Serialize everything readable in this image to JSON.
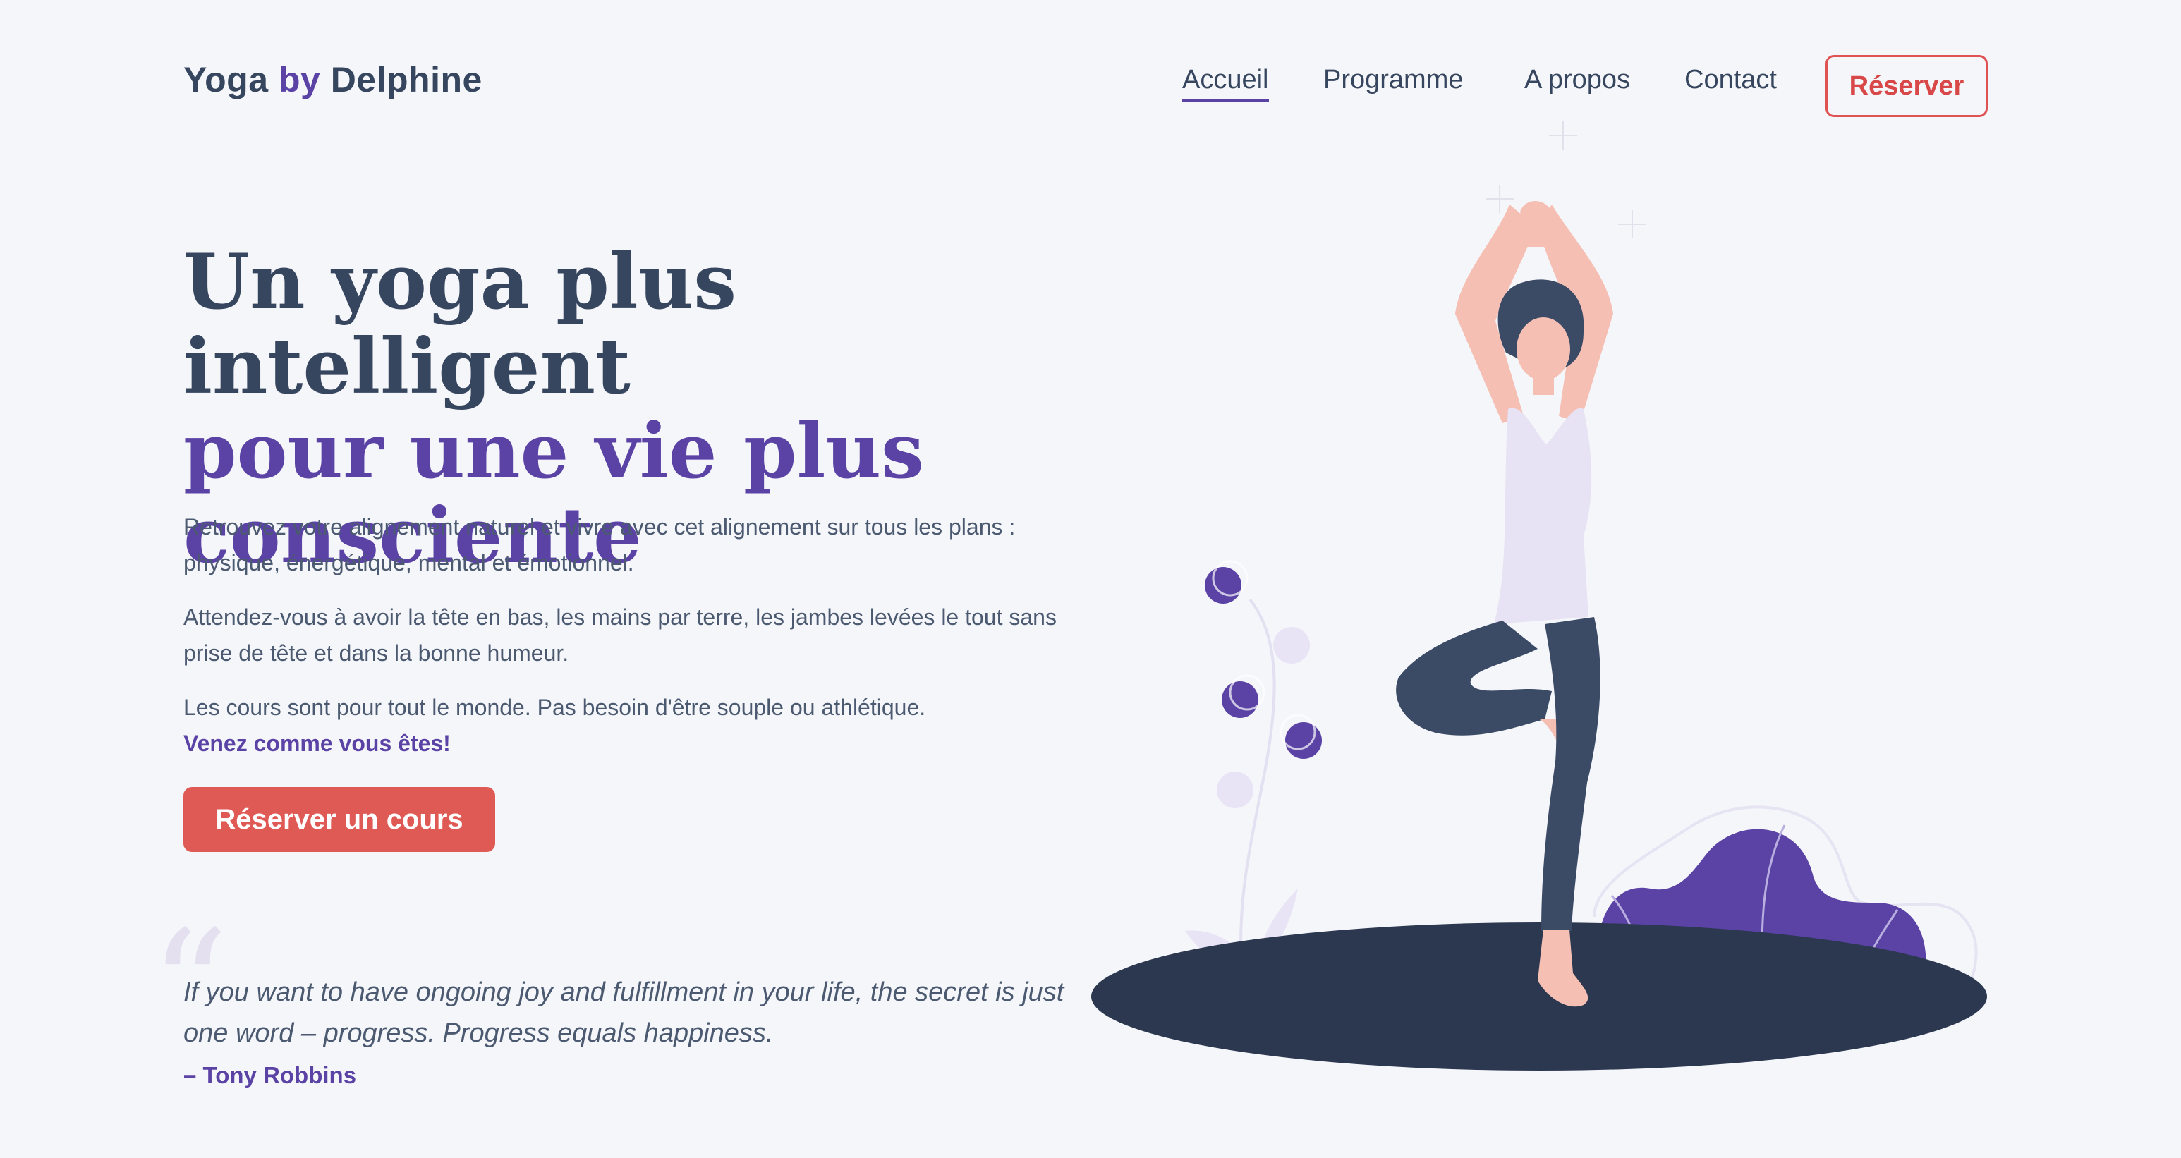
{
  "header": {
    "logo_part1": "Yoga",
    "logo_part2": "by",
    "logo_part3": "Delphine",
    "nav": [
      "Accueil",
      "Programme",
      "A propos",
      "Contact"
    ],
    "reserve_button": "Réserver"
  },
  "hero": {
    "headline_line1": "Un yoga plus intelligent",
    "headline_line2": "pour une vie plus",
    "headline_line3": "consciente",
    "paragraph1": "Retrouvez votre alignement naturel et vivre avec cet alignement sur tous les plans : physique, énergétique, mental et émotionnel.",
    "paragraph2": "Attendez-vous à avoir la tête en bas, les mains par terre, les jambes levées le tout sans prise de tête et dans la bonne humeur.",
    "paragraph3": "Les cours sont pour tout le monde. Pas besoin d'être souple ou athlétique.",
    "paragraph3_highlight": "Venez comme vous êtes!",
    "cta_button": "Réserver un cours"
  },
  "quote": {
    "mark": "“",
    "text": "If you want to have ongoing joy and fulfillment in your life, the secret is just one word – progress. Progress equals happiness.",
    "author": "– Tony Robbins"
  },
  "colors": {
    "background": "#f5f6fa",
    "heading_dark": "#37465f",
    "accent_purple": "#5b43a6",
    "cta_red": "#e05a55",
    "skin": "#f5bfb4",
    "top": "#e8e2f5",
    "pants": "#3b4b66",
    "mat": "#2b3850"
  },
  "icons": {
    "illustration": "yoga-tree-pose-illustration"
  }
}
